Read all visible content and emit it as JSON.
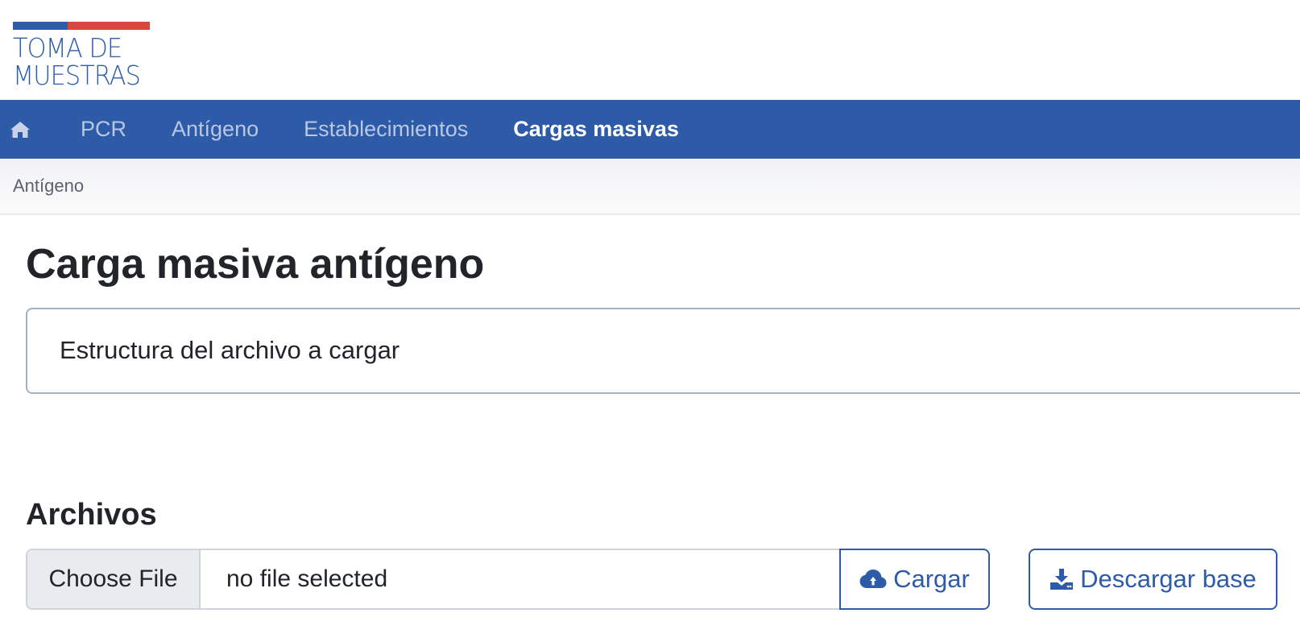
{
  "logo": {
    "line1": "TOMA DE",
    "line2": "MUESTRAS"
  },
  "nav": {
    "home_icon": "home-icon",
    "items": [
      {
        "label": "PCR",
        "active": false
      },
      {
        "label": "Antígeno",
        "active": false
      },
      {
        "label": "Establecimientos",
        "active": false
      },
      {
        "label": "Cargas masivas",
        "active": true
      }
    ]
  },
  "breadcrumb": {
    "current": "Antígeno"
  },
  "main": {
    "title": "Carga masiva antígeno",
    "card_title": "Estructura del archivo a cargar",
    "section_title": "Archivos",
    "file_input": {
      "button_label": "Choose File",
      "status": "no file selected"
    },
    "upload_button": {
      "label": "Cargar",
      "icon": "cloud-upload-icon"
    },
    "download_button": {
      "label": "Descargar base",
      "icon": "download-icon"
    }
  },
  "colors": {
    "brand_blue": "#2d5ba7",
    "brand_red": "#d8463d"
  }
}
